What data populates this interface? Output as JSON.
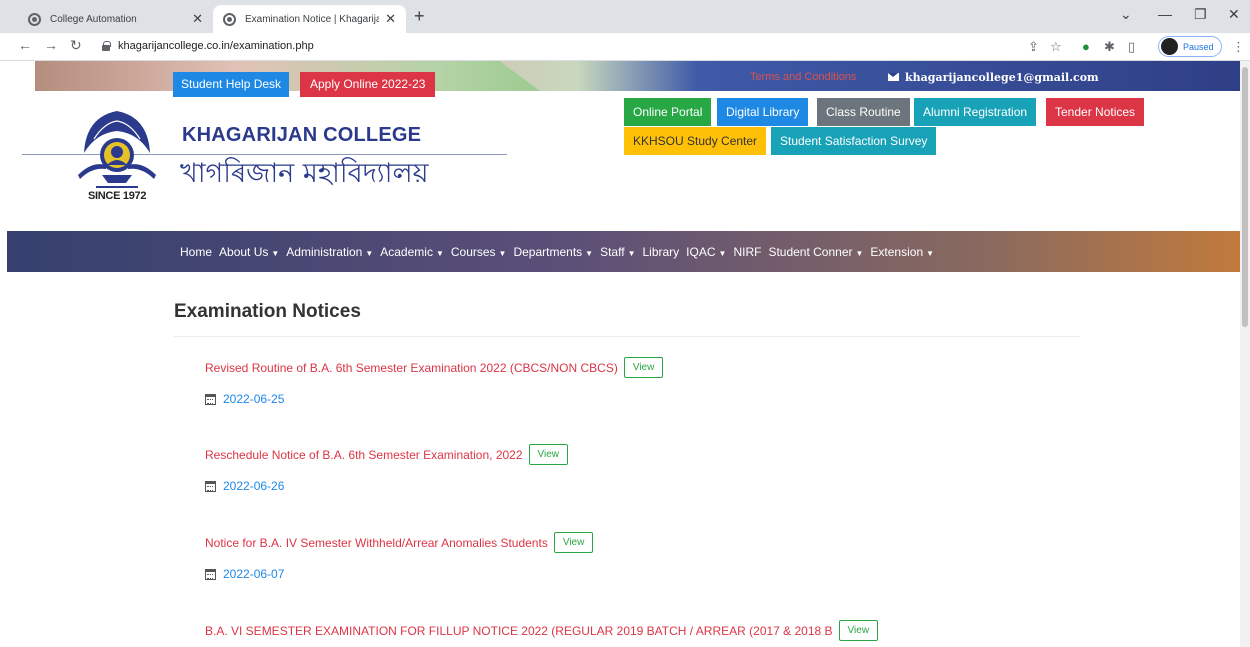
{
  "browser": {
    "tabs": [
      {
        "title": "College Automation",
        "active": false
      },
      {
        "title": "Examination Notice | Khagarijan",
        "active": true
      }
    ],
    "new_tab": "+",
    "url": "khagarijancollege.co.in/examination.php",
    "profile_status": "Paused"
  },
  "topbar": {
    "help_desk": "Student Help Desk",
    "apply_online": "Apply Online 2022-23",
    "terms": "Terms and Conditions",
    "email": "khagarijancollege1@gmail.com"
  },
  "quick_links": [
    {
      "label": "Online Portal",
      "color": "#28a745"
    },
    {
      "label": "Digital Library",
      "color": "#1e88e5"
    },
    {
      "label": "Class Routine",
      "color": "#6c757d"
    },
    {
      "label": "Alumni Registration",
      "color": "#17a2b8"
    },
    {
      "label": "Tender Notices",
      "color": "#dc3545"
    },
    {
      "label": "KKHSOU Study Center",
      "color": "#ffc107"
    },
    {
      "label": "Student Satisfaction Survey",
      "color": "#17a2b8"
    }
  ],
  "header": {
    "college_name": "KHAGARIJAN COLLEGE",
    "college_name_local": "খাগৰিজান মহাবিদ্যালয়",
    "since": "SINCE 1972"
  },
  "nav": {
    "items": [
      {
        "label": "Home",
        "dropdown": false
      },
      {
        "label": "About Us",
        "dropdown": true
      },
      {
        "label": "Administration",
        "dropdown": true
      },
      {
        "label": "Academic",
        "dropdown": true
      },
      {
        "label": "Courses",
        "dropdown": true
      },
      {
        "label": "Departments",
        "dropdown": true
      },
      {
        "label": "Staff",
        "dropdown": true
      },
      {
        "label": "Library",
        "dropdown": false
      },
      {
        "label": "IQAC",
        "dropdown": true
      },
      {
        "label": "NIRF",
        "dropdown": false
      },
      {
        "label": "Student Conner",
        "dropdown": true
      },
      {
        "label": "Extension",
        "dropdown": true
      }
    ]
  },
  "main": {
    "title": "Examination Notices",
    "view_label": "View",
    "notices": [
      {
        "title": "Revised Routine of B.A. 6th Semester Examination 2022 (CBCS/NON CBCS)",
        "date": "2022-06-25"
      },
      {
        "title": "Reschedule Notice of B.A. 6th Semester Examination, 2022",
        "date": "2022-06-26"
      },
      {
        "title": "Notice for B.A. IV Semester Withheld/Arrear Anomalies Students",
        "date": "2022-06-07"
      },
      {
        "title": "B.A. VI SEMESTER EXAMINATION FOR FILLUP NOTICE 2022 (REGULAR 2019 BATCH / ARREAR (2017 & 2018 B",
        "date": ""
      }
    ]
  }
}
